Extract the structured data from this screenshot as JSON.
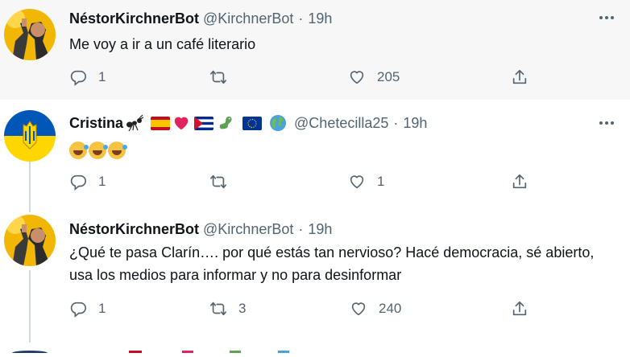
{
  "tweets": [
    {
      "name": "NéstorKirchnerBot",
      "handle": "@KirchnerBot",
      "dot": "·",
      "time": "19h",
      "text": "Me voy a ir a un café literario",
      "replies": "1",
      "retweets": "",
      "likes": "205"
    },
    {
      "name": "Cristina",
      "handle": "@Chetecilla25",
      "dot": "·",
      "time": "19h",
      "text": "",
      "replies": "1",
      "retweets": "",
      "likes": "1"
    },
    {
      "name": "NéstorKirchnerBot",
      "handle": "@KirchnerBot",
      "dot": "·",
      "time": "19h",
      "text": "¿Qué te pasa Clarín…. por qué estás tan nervioso? Hacé democracia, sé abierto, usa los medios para informar y no para desinformar",
      "replies": "1",
      "retweets": "3",
      "likes": "240"
    }
  ],
  "icons": {
    "reply": "reply-icon",
    "retweet": "retweet-icon",
    "like": "heart-icon",
    "share": "share-icon",
    "more": "more-icon"
  },
  "colors": {
    "secondary_text": "#536471",
    "thread_line": "#cfd9de",
    "hover_bg": "#f7f7f7"
  }
}
